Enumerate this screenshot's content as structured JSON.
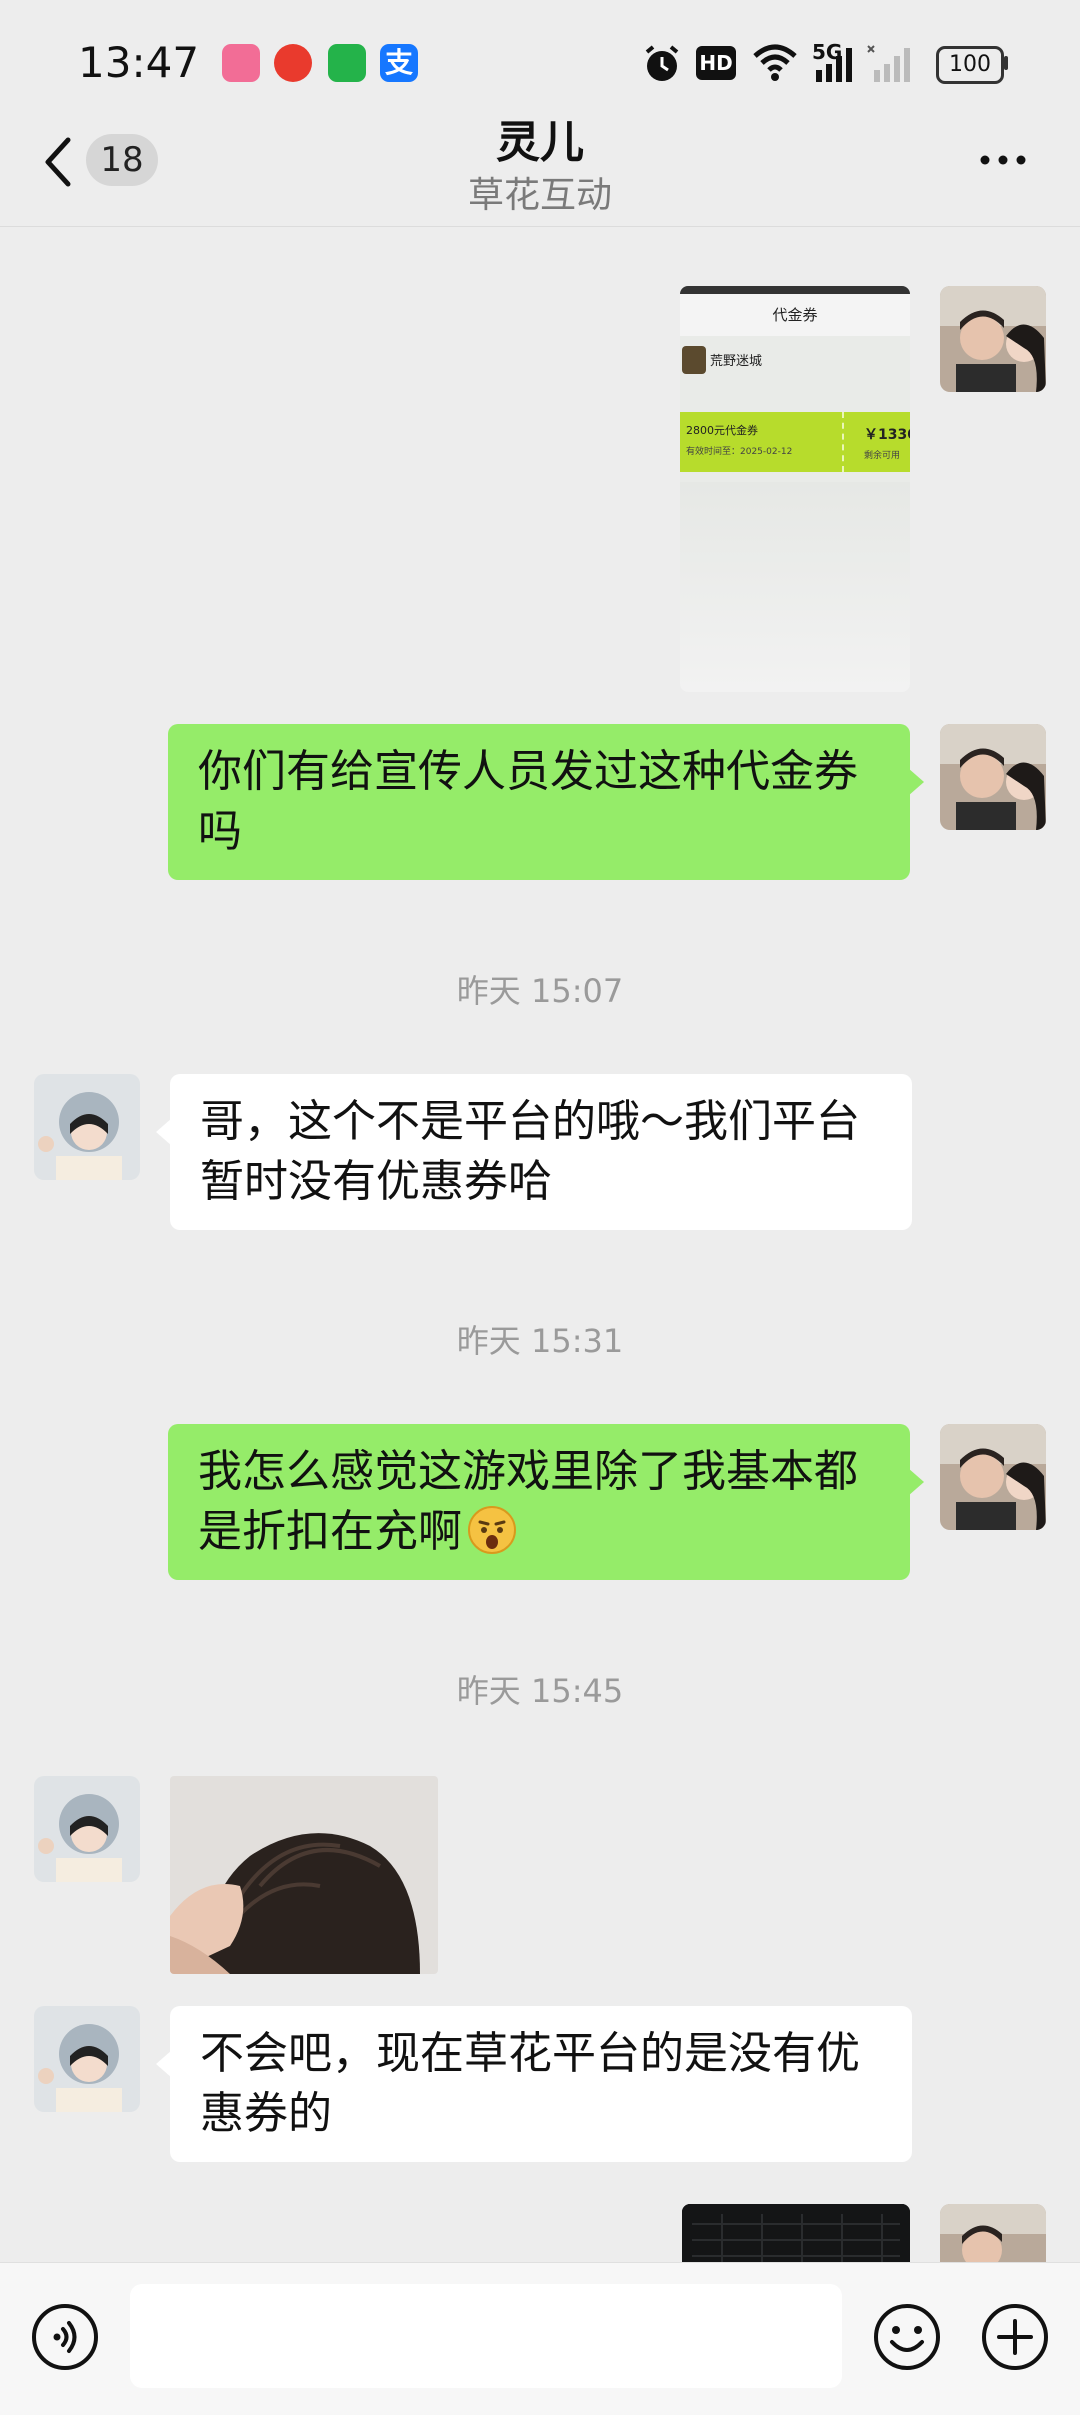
{
  "status": {
    "time": "13:47",
    "hd_label": "HD",
    "net_label": "5G",
    "battery": "100"
  },
  "header": {
    "back_count": "18",
    "title": "灵儿",
    "subtitle": "草花互动"
  },
  "voucher": {
    "screen_title": "代金券",
    "game_name": "荒野迷城",
    "voucher_name": "2800元代金券",
    "validity": "有效时间至：2025-02-12",
    "amount": "￥1330",
    "remaining": "剩余可用"
  },
  "messages": [
    {
      "from": "me",
      "text": "你们有给宣传人员发过这种代金券吗"
    },
    {
      "timestamp": "昨天 15:07"
    },
    {
      "from": "them",
      "text": "哥，这个不是平台的哦～我们平台暂时没有优惠券哈"
    },
    {
      "timestamp": "昨天 15:31"
    },
    {
      "from": "me",
      "text": "我怎么感觉这游戏里除了我基本都是折扣在充啊"
    },
    {
      "timestamp": "昨天 15:45"
    },
    {
      "from": "them",
      "text": "不会吧，现在草花平台的是没有优惠券的"
    }
  ],
  "input": {
    "value": ""
  },
  "colors": {
    "my_bubble": "#95ec69",
    "their_bubble": "#ffffff",
    "background": "#ededed"
  }
}
